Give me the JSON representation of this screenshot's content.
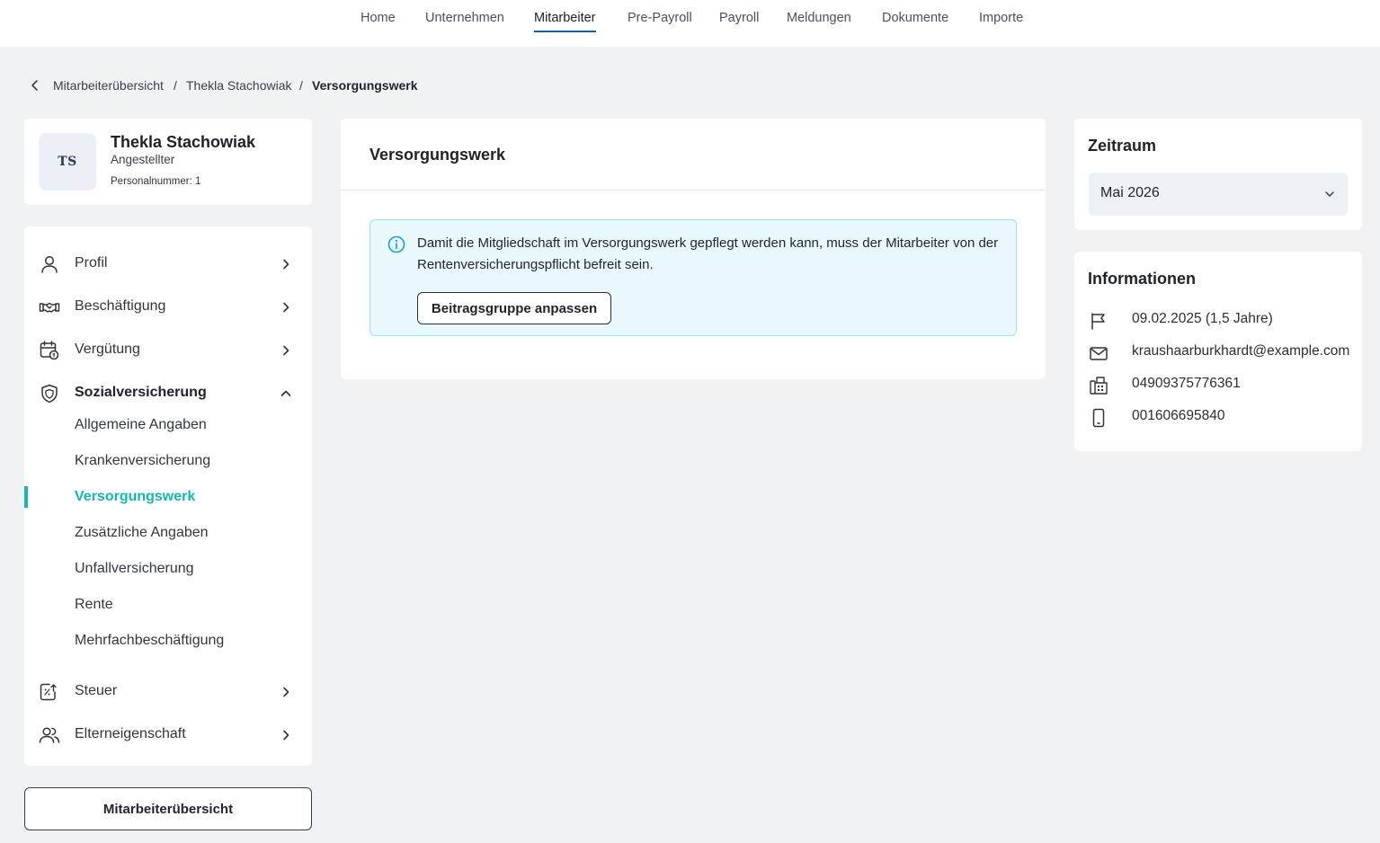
{
  "nav": {
    "items": [
      {
        "label": "Home"
      },
      {
        "label": "Unternehmen"
      },
      {
        "label": "Mitarbeiter",
        "active": true
      },
      {
        "label": "Pre-Payroll"
      },
      {
        "label": "Payroll"
      },
      {
        "label": "Meldungen"
      },
      {
        "label": "Dokumente"
      },
      {
        "label": "Importe"
      }
    ]
  },
  "breadcrumb": {
    "items": [
      "Mitarbeiterübersicht",
      "Thekla Stachowiak",
      "Versorgungswerk"
    ],
    "separator": "/"
  },
  "profile": {
    "initials": "TS",
    "name": "Thekla Stachowiak",
    "role": "Angestellter",
    "personnel_number": "Personalnummer: 1"
  },
  "sidebar": {
    "sections": [
      {
        "label": "Profil",
        "icon": "user-icon"
      },
      {
        "label": "Beschäftigung",
        "icon": "handshake-icon"
      },
      {
        "label": "Vergütung",
        "icon": "calendar-money-icon"
      },
      {
        "label": "Sozialversicherung",
        "icon": "shield-icon",
        "expanded": true
      },
      {
        "label": "Steuer",
        "icon": "tax-icon"
      },
      {
        "label": "Elterneigenschaft",
        "icon": "users-icon"
      }
    ],
    "sub_items": [
      {
        "label": "Allgemeine Angaben"
      },
      {
        "label": "Krankenversicherung"
      },
      {
        "label": "Versorgungswerk",
        "active": true
      },
      {
        "label": "Zusätzliche Angaben"
      },
      {
        "label": "Unfallversicherung"
      },
      {
        "label": "Rente"
      },
      {
        "label": "Mehrfachbeschäftigung"
      }
    ],
    "overview_button": "Mitarbeiterübersicht"
  },
  "main": {
    "title": "Versorgungswerk",
    "info_message": "Damit die Mitgliedschaft im Versorgungswerk gepflegt werden kann, muss der Mitarbeiter von der Rentenversicherungspflicht befreit sein.",
    "info_button": "Beitragsgruppe anpassen"
  },
  "zeitraum": {
    "title": "Zeitraum",
    "selected": "Mai 2026"
  },
  "informationen": {
    "title": "Informationen",
    "rows": [
      {
        "icon": "flag-icon",
        "text": "09.02.2025 (1,5 Jahre)"
      },
      {
        "icon": "mail-icon",
        "text": "kraushaarburkhardt@example.com"
      },
      {
        "icon": "fax-icon",
        "text": "04909375776361"
      },
      {
        "icon": "mobile-icon",
        "text": "001606695840"
      }
    ]
  },
  "colors": {
    "accent": "#13b8b0",
    "nav_underline": "#1a5ba8",
    "info_bg": "#e8f8fc",
    "info_border": "#9fe0ee"
  }
}
